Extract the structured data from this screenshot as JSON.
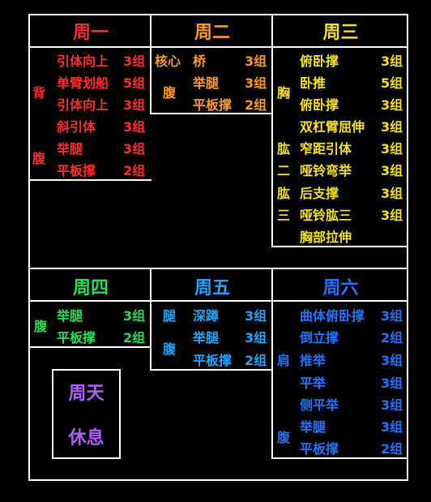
{
  "colors": {
    "mon": "#ff2a2a",
    "tue": "#ff9b1a",
    "wed": "#f4e11a",
    "thu": "#23e05a",
    "fri": "#1fa6ff",
    "sat": "#1f74ff",
    "sun": "#b45cff"
  },
  "mon": {
    "title": "周一",
    "groups": [
      {
        "label": "背",
        "rows": [
          {
            "name": "引体向上",
            "sets": "3组"
          },
          {
            "name": "单臂划船",
            "sets": "5组"
          },
          {
            "name": "引体向上",
            "sets": "3组"
          }
        ]
      },
      {
        "label": "腹",
        "rows": [
          {
            "name": "斜引体",
            "sets": "3组"
          },
          {
            "name": "举腿",
            "sets": "3组"
          },
          {
            "name": "平板撑",
            "sets": "2组"
          }
        ]
      }
    ]
  },
  "tue": {
    "title": "周二",
    "groups": [
      {
        "label": "核心",
        "rows": [
          {
            "name": "桥",
            "sets": "3组"
          }
        ]
      },
      {
        "label": "腹",
        "rows": [
          {
            "name": "举腿",
            "sets": "3组"
          },
          {
            "name": "平板撑",
            "sets": "2组"
          }
        ]
      }
    ]
  },
  "wed": {
    "title": "周三",
    "labels": [
      "胸",
      "肱",
      "二",
      "肱",
      "三"
    ],
    "rows": [
      {
        "name": "俯卧撑",
        "sets": "3组"
      },
      {
        "name": "卧推",
        "sets": "5组"
      },
      {
        "name": "俯卧撑",
        "sets": "3组"
      },
      {
        "name": "双杠臂屈伸",
        "sets": "3组"
      },
      {
        "name": "窄距引体",
        "sets": "3组"
      },
      {
        "name": "哑铃弯举",
        "sets": "3组"
      },
      {
        "name": "后支撑",
        "sets": "3组"
      },
      {
        "name": "哑铃肱三",
        "sets": "3组"
      },
      {
        "name": "胸部拉伸",
        "sets": ""
      }
    ]
  },
  "thu": {
    "title": "周四",
    "label": "腹",
    "rows": [
      {
        "name": "举腿",
        "sets": "3组"
      },
      {
        "name": "平板撑",
        "sets": "2组"
      }
    ]
  },
  "fri": {
    "title": "周五",
    "labels": [
      "腿",
      "腹"
    ],
    "rows": [
      {
        "name": "深蹲",
        "sets": "3组"
      },
      {
        "name": "举腿",
        "sets": "3组"
      },
      {
        "name": "平板撑",
        "sets": "2组"
      }
    ]
  },
  "sat": {
    "title": "周六",
    "labels": [
      "肩",
      "腹"
    ],
    "rows": [
      {
        "name": "曲体俯卧撑",
        "sets": "3组"
      },
      {
        "name": "倒立撑",
        "sets": "2组"
      },
      {
        "name": "推举",
        "sets": "3组"
      },
      {
        "name": "平举",
        "sets": "3组"
      },
      {
        "name": "侧平举",
        "sets": "3组"
      },
      {
        "name": "举腿",
        "sets": "3组"
      },
      {
        "name": "平板撑",
        "sets": "2组"
      }
    ]
  },
  "sun": {
    "title": "周天",
    "note": "休息"
  }
}
